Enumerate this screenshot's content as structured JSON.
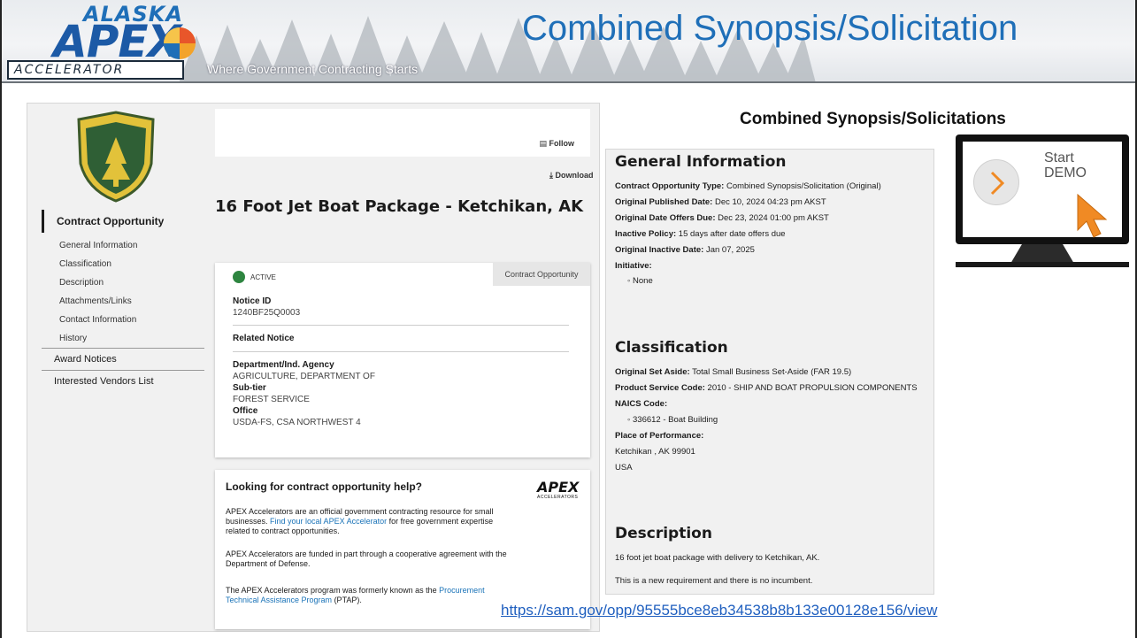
{
  "header": {
    "logo_alaska": "ALASKA",
    "logo_apex": "APEX",
    "logo_accelerator": "ACCELERATOR",
    "tagline": "Where Government Contracting Starts",
    "headline": "Combined Synopsis/Solicitation"
  },
  "section_label": "Combined Synopsis/Solicitations",
  "sam": {
    "nav": {
      "active": "Contract Opportunity",
      "subs": [
        "General Information",
        "Classification",
        "Description",
        "Attachments/Links",
        "Contact Information",
        "History"
      ],
      "tops": [
        "Award Notices",
        "Interested Vendors List"
      ]
    },
    "follow": "Follow",
    "download": "Download",
    "title": "16 Foot Jet Boat Package - Ketchikan, AK",
    "card": {
      "status": "ACTIVE",
      "tab": "Contract Opportunity",
      "notice_id_label": "Notice ID",
      "notice_id": "1240BF25Q0003",
      "related_label": "Related Notice",
      "dept_label": "Department/Ind. Agency",
      "dept": "AGRICULTURE, DEPARTMENT OF",
      "subtier_label": "Sub-tier",
      "subtier": "FOREST SERVICE",
      "office_label": "Office",
      "office": "USDA-FS, CSA NORTHWEST 4"
    },
    "help": {
      "heading": "Looking for contract opportunity help?",
      "brand": "APEX",
      "brand_sub": "ACCELERATORS",
      "p1_a": "APEX Accelerators are an official government contracting resource for small businesses. ",
      "p1_link": "Find your local APEX Accelerator",
      "p1_b": " for free government expertise related to contract opportunities.",
      "p2": "APEX Accelerators are funded in part through a cooperative agreement with the Department of Defense.",
      "p3_a": "The APEX Accelerators program was formerly known as the ",
      "p3_link": "Procurement Technical Assistance Program",
      "p3_b": " (PTAP)."
    }
  },
  "info": {
    "general_heading": "General Information",
    "opp_type_label": "Contract Opportunity Type:",
    "opp_type": " Combined Synopsis/Solicitation (Original)",
    "pub_label": "Original Published Date:",
    "pub": " Dec 10, 2024 04:23 pm AKST",
    "due_label": "Original Date Offers Due:",
    "due": " Dec 23, 2024 01:00 pm AKST",
    "inactive_policy_label": "Inactive Policy:",
    "inactive_policy": " 15 days after date offers due",
    "inactive_date_label": "Original Inactive Date:",
    "inactive_date": " Jan 07, 2025",
    "initiative_label": "Initiative:",
    "initiative": "None",
    "class_heading": "Classification",
    "set_aside_label": "Original Set Aside:",
    "set_aside": " Total Small Business Set-Aside (FAR 19.5)",
    "psc_label": "Product Service Code:",
    "psc": " 2010 - SHIP AND BOAT PROPULSION COMPONENTS",
    "naics_label": "NAICS Code:",
    "naics": "336612 - Boat Building",
    "pop_label": "Place of Performance:",
    "pop_city": "Ketchikan , AK 99901",
    "pop_country": "USA",
    "desc_heading": "Description",
    "desc1": "16 foot jet boat package with delivery to Ketchikan, AK.",
    "desc2": "This is a new requirement and there is no incumbent."
  },
  "demo": {
    "line1": "Start",
    "line2": "DEMO"
  },
  "url": "https://sam.gov/opp/95555bce8eb34538b8b133e00128e156/view",
  "colors": {
    "apex_blue": "#1c5aa6",
    "headline_blue": "#1f6fb8",
    "active_green": "#2e8540",
    "link_blue": "#1a73b8",
    "cursor_orange": "#f08a24"
  }
}
